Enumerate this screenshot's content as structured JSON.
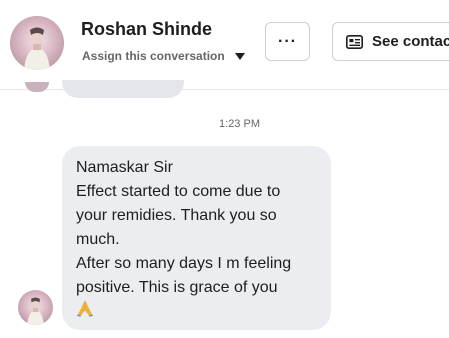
{
  "header": {
    "contact_name": "Roshan Shinde",
    "assign_label": "Assign this conversation",
    "more_label": "···",
    "see_contact_label": "See contact"
  },
  "thread": {
    "timestamp": "1:23 PM",
    "message_lines": [
      "Namaskar Sir",
      "Effect started to come due to",
      "your remidies. Thank you so",
      "much.",
      "After so many days I m feeling",
      "positive. This is grace of you"
    ],
    "emoji_icon": "folded-hands-emoji"
  },
  "colors": {
    "bubble": "#ecedf0",
    "text": "#1c1e21",
    "muted": "#65676b",
    "border": "#ced0d4"
  }
}
